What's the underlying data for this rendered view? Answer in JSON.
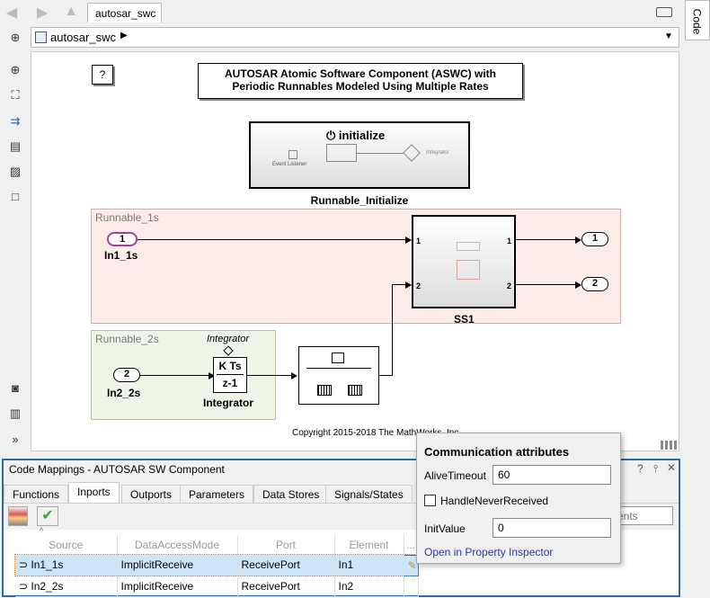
{
  "window": {
    "tab_label": "autosar_swc",
    "breadcrumb": "autosar_swc",
    "code_tab": "Code"
  },
  "canvas": {
    "help_label": "?",
    "title": "AUTOSAR Atomic Software Component (ASWC) with Periodic Runnables Modeled Using Multiple Rates",
    "init_block": {
      "title": "initialize",
      "event_listener": "Event Listener",
      "integrator": "Integrator",
      "name": "Runnable_Initialize"
    },
    "runnable_1s": {
      "label": "Runnable_1s",
      "inport_num": "1",
      "inport_name": "In1_1s"
    },
    "runnable_2s": {
      "label": "Runnable_2s",
      "inport_num": "2",
      "inport_name": "In2_2s",
      "integrator_top": "Integrator",
      "integrator_num": "K Ts",
      "integrator_den": "z-1",
      "integrator_name": "Integrator"
    },
    "ss1": {
      "name": "SS1",
      "in1": "1",
      "in2": "2",
      "out1": "1",
      "out2": "2"
    },
    "outports": [
      "1",
      "2"
    ],
    "copyright": "Copyright 2015-2018 The MathWorks, Inc."
  },
  "panel": {
    "title": "Code Mappings - AUTOSAR SW Component",
    "tabs": [
      "Functions",
      "Inports",
      "Outports",
      "Parameters",
      "Data Stores",
      "Signals/States"
    ],
    "active_tab": "Inports",
    "search_placeholder": "ents",
    "columns": [
      "Source",
      "DataAccessMode",
      "Port",
      "Element",
      "..."
    ],
    "rows": [
      {
        "source": "In1_1s",
        "mode": "ImplicitReceive",
        "port": "ReceivePort",
        "element": "In1",
        "selected": true
      },
      {
        "source": "In2_2s",
        "mode": "ImplicitReceive",
        "port": "ReceivePort",
        "element": "In2",
        "selected": false
      }
    ]
  },
  "popup": {
    "title": "Communication attributes",
    "alive_label": "AliveTimeout",
    "alive_value": "60",
    "handle_label": "HandleNeverReceived",
    "handle_checked": false,
    "init_label": "InitValue",
    "init_value": "0",
    "link": "Open in Property Inspector"
  },
  "colors": {
    "accent": "#2c6aa6",
    "runnable1_bg": "#fcece8",
    "runnable2_bg": "#eef5e6",
    "selected_row": "#cce4f7",
    "inport1_border": "#a0409a"
  }
}
